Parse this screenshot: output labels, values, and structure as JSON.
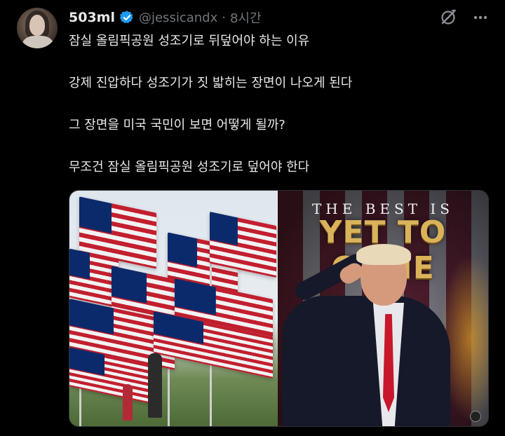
{
  "author": {
    "display_name": "503ml",
    "handle": "@jessicandx",
    "separator": "·",
    "time": "8시간",
    "verified": true,
    "avatar_icon": "avatar-photo"
  },
  "header_icons": [
    "grok-icon",
    "more-icon"
  ],
  "tweet": {
    "lines": [
      "잠실 올림픽공원 성조기로 뒤덮어야 하는 이유",
      "강제 진압하다 성조기가 짓 밟히는 장면이 나오게 된다",
      "그 장면을 미국 국민이 보면 어떻게 될까?",
      "무조건 잠실 올림픽공원 성조기로 덮어야 한다"
    ]
  },
  "media": {
    "left_image": "flags-on-lawn-photo",
    "right_image": {
      "headline_top": "THE BEST IS",
      "headline_big": "YET TO COME"
    }
  },
  "colors": {
    "background": "#000000",
    "text": "#e7e9ea",
    "muted": "#71767b",
    "verified_blue": "#1d9bf0"
  }
}
